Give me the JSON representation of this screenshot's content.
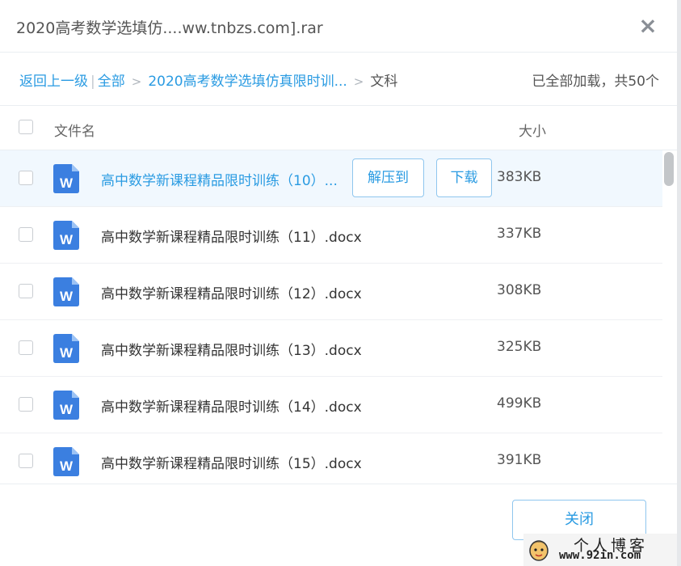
{
  "header": {
    "title": "2020高考数学选填仿....ww.tnbzs.com].rar",
    "close_label": "✕"
  },
  "breadcrumb": {
    "back": "返回上一级",
    "sep": "|",
    "all": "全部",
    "arrow": ">",
    "folder": "2020高考数学选填仿真限时训...",
    "current": "文科"
  },
  "status": "已全部加载，共50个",
  "table": {
    "col_name": "文件名",
    "col_size": "大小"
  },
  "files": [
    {
      "name": "高中数学新课程精品限时训练（10）...",
      "size": "383KB"
    },
    {
      "name": "高中数学新课程精品限时训练（11）.docx",
      "size": "337KB"
    },
    {
      "name": "高中数学新课程精品限时训练（12）.docx",
      "size": "308KB"
    },
    {
      "name": "高中数学新课程精品限时训练（13）.docx",
      "size": "325KB"
    },
    {
      "name": "高中数学新课程精品限时训练（14）.docx",
      "size": "499KB"
    },
    {
      "name": "高中数学新课程精品限时训练（15）.docx",
      "size": "391KB"
    }
  ],
  "row_actions": {
    "extract": "解压到",
    "download": "下载"
  },
  "file_icon": {
    "name": "word-doc-icon",
    "letter": "W",
    "color": "#3b7fe0"
  },
  "footer": {
    "close_button": "关闭"
  },
  "watermark": {
    "title": "个人博客",
    "url": "www.92in.com"
  },
  "colors": {
    "accent": "#2a9be2",
    "row_highlight": "#f1f8fe"
  }
}
